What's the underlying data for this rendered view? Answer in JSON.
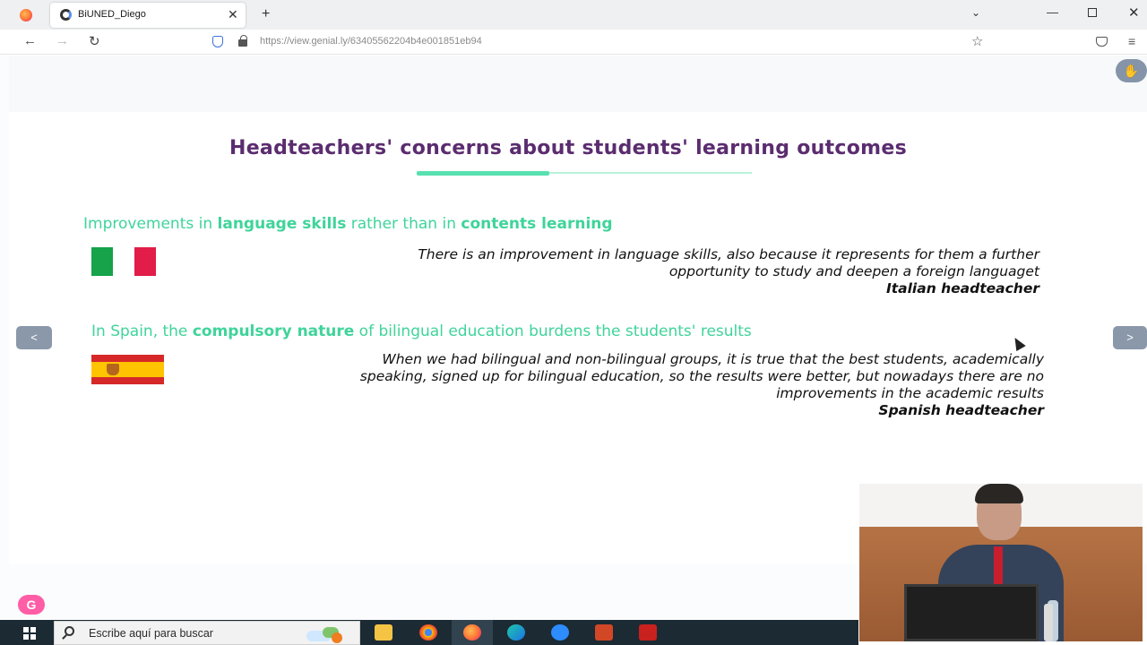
{
  "browser": {
    "tab_title": "BiUNED_Diego",
    "url_domain": "https://view.genial.ly",
    "url_path": "/63405562204b4e001851eb94"
  },
  "slide": {
    "title": "Headteachers' concerns about students' learning outcomes",
    "italy": {
      "head_pre": "Improvements in ",
      "head_b1": "language skills",
      "head_mid": " rather than in ",
      "head_b2": "contents learning",
      "quote_line1": "There is an improvement in language skills, also because it represents for them a further",
      "quote_line2": "opportunity to study and deepen a foreign languaget",
      "author": "Italian headteacher"
    },
    "spain": {
      "head_pre": "In Spain, the ",
      "head_b1": "compulsory nature",
      "head_post": " of bilingual education burdens the students' results",
      "quote_line1": "When we had bilingual and non-bilingual groups, it is true that the best students, academically",
      "quote_line2": "speaking, signed up for bilingual education, so the results were better, but nowadays there are no",
      "quote_line3": "improvements in the academic results",
      "author": "Spanish headteacher"
    },
    "prev_label": "<",
    "next_label": ">"
  },
  "taskbar": {
    "search_placeholder": "Escribe aquí para buscar"
  },
  "colors": {
    "title": "#5b2c6f",
    "accent": "#3fd49a"
  },
  "icons": [
    "firefox-icon",
    "genially-favicon",
    "close-icon",
    "plus-icon",
    "chevron-down-icon",
    "back-icon",
    "forward-icon",
    "reload-icon",
    "shield-icon",
    "lock-icon",
    "star-icon",
    "pocket-icon",
    "menu-icon",
    "hand-icon",
    "cursor-icon",
    "windows-start-icon",
    "search-icon"
  ]
}
